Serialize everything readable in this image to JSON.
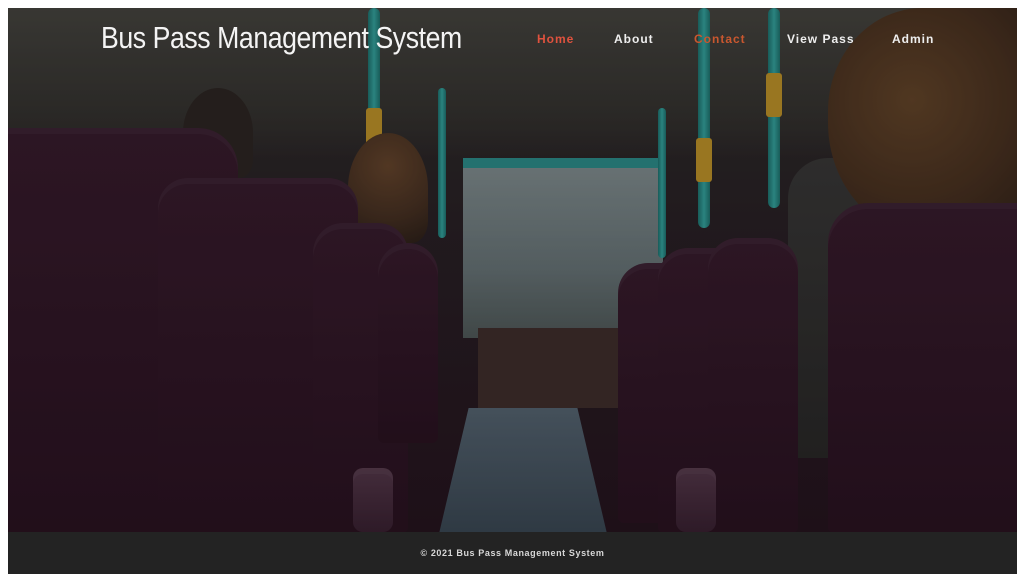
{
  "header": {
    "brand_title": "Bus Pass Management System"
  },
  "nav": {
    "items": [
      {
        "label": "Home",
        "state": "active"
      },
      {
        "label": "About",
        "state": "normal"
      },
      {
        "label": "Contact",
        "state": "accent"
      },
      {
        "label": "View Pass",
        "state": "normal"
      },
      {
        "label": "Admin",
        "state": "normal"
      }
    ]
  },
  "footer": {
    "copyright": "© 2021 Bus Pass Management System"
  },
  "colors": {
    "nav_active": "#e0523e",
    "nav_text": "#eeeeee",
    "footer_bg": "#232323",
    "pole": "#37b3ac",
    "seat": "#3a1c2e"
  }
}
